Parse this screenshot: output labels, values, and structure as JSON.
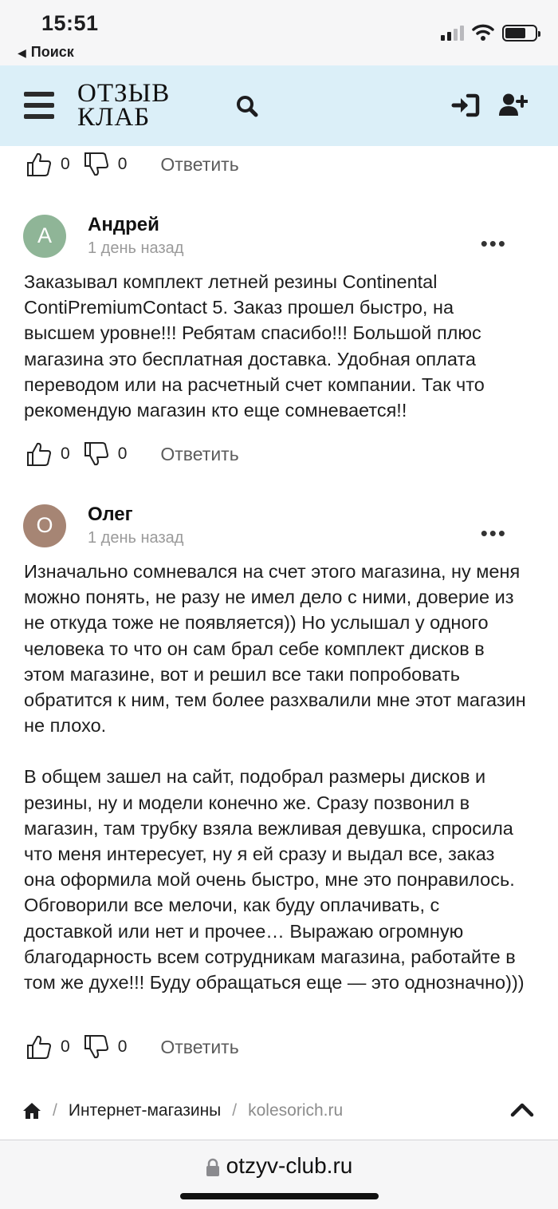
{
  "status_bar": {
    "time": "15:51",
    "back_label": "Поиск"
  },
  "header": {
    "logo_line1": "ОТЗЫВ",
    "logo_line2": "КЛАБ"
  },
  "top_votes": {
    "likes": "0",
    "dislikes": "0",
    "reply": "Ответить"
  },
  "comments": [
    {
      "avatar_letter": "А",
      "avatar_color": "#8fb597",
      "name": "Андрей",
      "date": "1 день назад",
      "paragraphs": [
        "Заказывал комплект летней резины Continental ContiPremiumContact 5. Заказ прошел быстро, на высшем уровне!!! Ребятам спасибо!!! Большой плюс магазина это бесплатная доставка. Удобная оплата переводом или на расчетный счет компании. Так что рекомендую магазин кто еще сомневается!!"
      ],
      "likes": "0",
      "dislikes": "0",
      "reply": "Ответить"
    },
    {
      "avatar_letter": "О",
      "avatar_color": "#a68574",
      "name": "Олег",
      "date": "1 день назад",
      "paragraphs": [
        "Изначально сомневался на счет этого магазина, ну меня можно понять, не разу не имел дело с ними, доверие из не откуда тоже не появляется)) Но услышал у одного человека то что он сам брал себе комплект дисков в этом магазине, вот и решил все таки попробовать обратится к ним, тем более разхвалили мне этот магазин не плохо.",
        "В общем зашел на сайт, подобрал размеры дисков и резины, ну и модели конечно же. Сразу позвонил в магазин, там трубку взяла вежливая девушка, спросила что меня интересует, ну я ей сразу и выдал все, заказ она оформила мой очень быстро, мне это понравилось. Обговорили все мелочи, как буду оплачивать, с доставкой или нет и прочее… Выражаю огромную благодарность всем сотрудникам магазина, работайте в том же духе!!! Буду обращаться еще — это однозначно)))"
      ],
      "likes": "0",
      "dislikes": "0",
      "reply": "Ответить"
    }
  ],
  "breadcrumbs": {
    "category": "Интернет-магазины",
    "current": "kolesorich.ru"
  },
  "address_bar": {
    "url": "otzyv-club.ru"
  },
  "icons": {
    "menu": "hamburger-icon",
    "search": "search-icon",
    "login": "sign-in-icon",
    "register": "user-plus-icon",
    "like": "thumbs-up-icon",
    "dislike": "thumbs-down-icon",
    "home": "home-icon",
    "up": "chevron-up-icon",
    "lock": "lock-icon"
  }
}
